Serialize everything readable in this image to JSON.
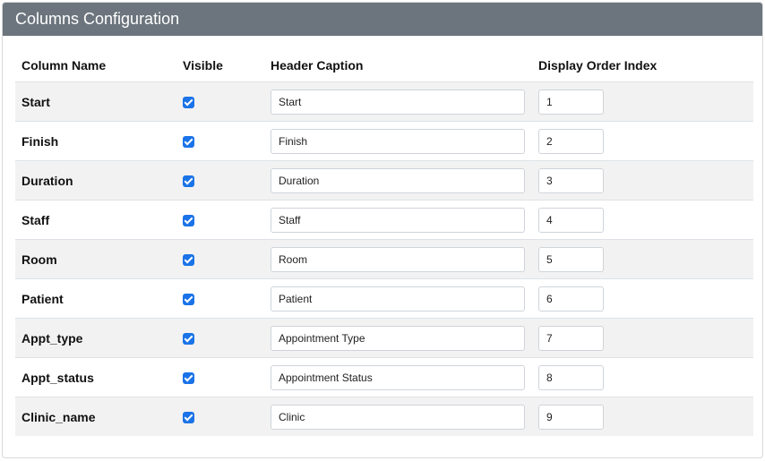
{
  "panel": {
    "title": "Columns Configuration"
  },
  "table": {
    "headers": {
      "column_name": "Column Name",
      "visible": "Visible",
      "header_caption": "Header Caption",
      "display_order": "Display Order Index"
    },
    "rows": [
      {
        "name": "Start",
        "visible": true,
        "caption": "Start",
        "order": "1"
      },
      {
        "name": "Finish",
        "visible": true,
        "caption": "Finish",
        "order": "2"
      },
      {
        "name": "Duration",
        "visible": true,
        "caption": "Duration",
        "order": "3"
      },
      {
        "name": "Staff",
        "visible": true,
        "caption": "Staff",
        "order": "4"
      },
      {
        "name": "Room",
        "visible": true,
        "caption": "Room",
        "order": "5"
      },
      {
        "name": "Patient",
        "visible": true,
        "caption": "Patient",
        "order": "6"
      },
      {
        "name": "Appt_type",
        "visible": true,
        "caption": "Appointment Type",
        "order": "7"
      },
      {
        "name": "Appt_status",
        "visible": true,
        "caption": "Appointment Status",
        "order": "8"
      },
      {
        "name": "Clinic_name",
        "visible": true,
        "caption": "Clinic",
        "order": "9"
      }
    ]
  },
  "colors": {
    "header_bg": "#6c757d",
    "checkbox": "#1a73e8",
    "stripe": "#f2f2f2"
  }
}
